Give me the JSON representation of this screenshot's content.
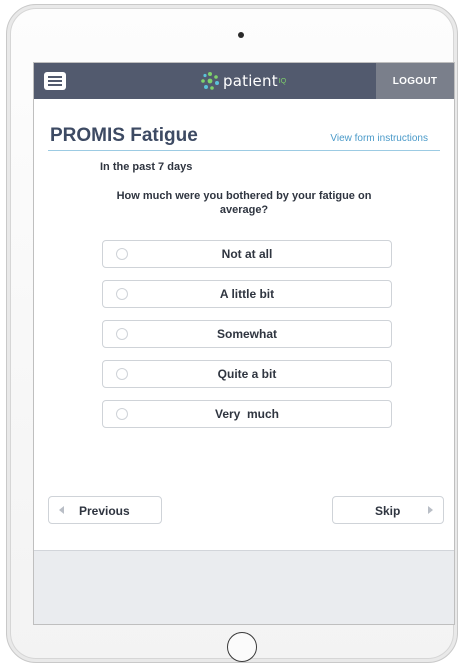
{
  "header": {
    "brand_name": "patient",
    "brand_superscript": "IQ",
    "menu_icon": "hamburger-menu-icon",
    "logo_icon": "patientiq-dots-logo-icon",
    "logout_label": "LOGOUT",
    "colors": {
      "header_bg": "#525a6e",
      "logout_bg": "#7a7f8b",
      "logo_accent": "#7fd36b"
    }
  },
  "form": {
    "title": "PROMIS Fatigue",
    "instructions_link": "View form instructions",
    "timeframe": "In the past 7 days",
    "question": "How much were you bothered by your fatigue on average?",
    "options": [
      {
        "label": "Not at all",
        "selected": false
      },
      {
        "label": "A little bit",
        "selected": false
      },
      {
        "label": "Somewhat",
        "selected": false
      },
      {
        "label": "Quite a bit",
        "selected": false
      },
      {
        "label": "Very  much",
        "selected": false
      }
    ],
    "colors": {
      "title": "#3d4a63",
      "link": "#4a9ac9",
      "rule": "#9ccbe3"
    }
  },
  "navigation": {
    "previous_label": "Previous",
    "skip_label": "Skip"
  }
}
